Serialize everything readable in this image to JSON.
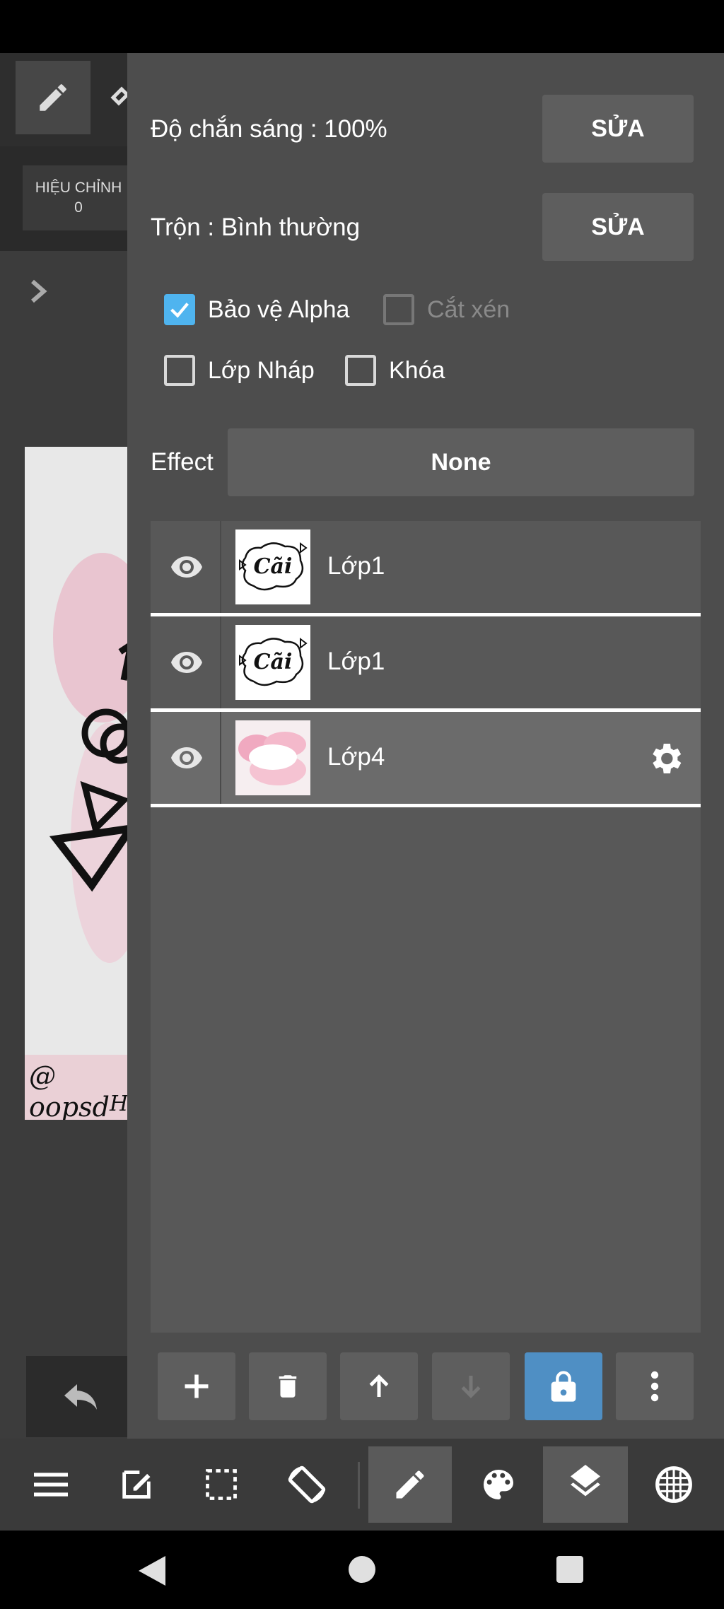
{
  "left": {
    "correction_label": "HIỆU CHỈNH",
    "correction_value": "0",
    "canvas_text": "@ oopsd",
    "canvas_text2": "H"
  },
  "panel": {
    "opacity_label": "Độ chắn sáng : 100%",
    "opacity_edit": "SỬA",
    "blend_label": "Trộn : Bình thường",
    "blend_edit": "SỬA",
    "checkboxes": [
      {
        "label": "Bảo vệ Alpha",
        "checked": true,
        "enabled": true
      },
      {
        "label": "Cắt xén",
        "checked": false,
        "enabled": false
      },
      {
        "label": "Lớp Nháp",
        "checked": false,
        "enabled": true
      },
      {
        "label": "Khóa",
        "checked": false,
        "enabled": true
      }
    ],
    "effect_label": "Effect",
    "effect_value": "None"
  },
  "layers": [
    {
      "name": "Lớp1",
      "thumb_text": "Cãi",
      "visible": true,
      "selected": false
    },
    {
      "name": "Lớp1",
      "thumb_text": "Cãi",
      "visible": true,
      "selected": false
    },
    {
      "name": "Lớp4",
      "thumb_text": "",
      "visible": true,
      "selected": true
    }
  ],
  "layer_toolbar": [
    "add-icon",
    "trash-icon",
    "arrow-up-icon",
    "arrow-down-icon",
    "lock-icon",
    "more-vertical-icon"
  ],
  "bottom_toolbar": [
    "menu-icon",
    "edit-icon",
    "selection-icon",
    "rotate-icon",
    "brush-icon",
    "palette-icon",
    "layers-icon",
    "grid-icon"
  ],
  "colors": {
    "accent": "#4fb4ef",
    "lock_active": "#4f8fc4",
    "panel": "#4d4d4d"
  }
}
